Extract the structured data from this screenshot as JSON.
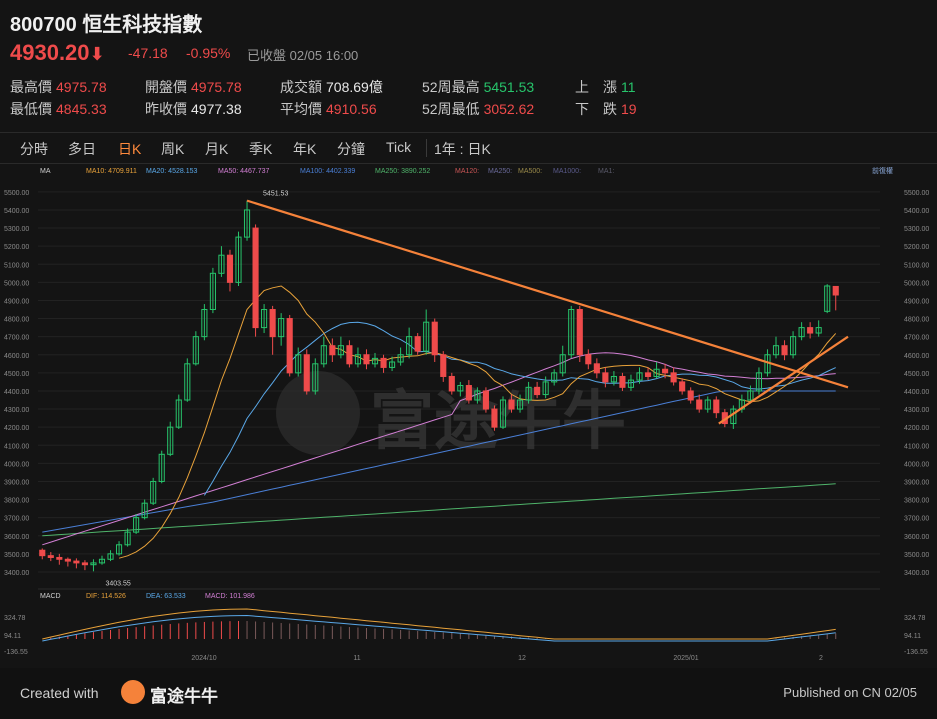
{
  "header": {
    "code": "800700",
    "name": "恒生科技指數",
    "price": "4930.20",
    "arrow": "⬇",
    "change": "-47.18",
    "change_pct": "-0.95%",
    "status": "已收盤 02/05 16:00"
  },
  "stats": [
    {
      "label": "最高價",
      "value": "4975.78",
      "color": "red"
    },
    {
      "label": "開盤價",
      "value": "4975.78",
      "color": "red"
    },
    {
      "label": "成交額",
      "value": "708.69億",
      "color": "white"
    },
    {
      "label": "52周最高",
      "value": "5451.53",
      "color": "green"
    },
    {
      "label": "上　漲",
      "value": "11",
      "color": "green"
    },
    {
      "label": "最低價",
      "value": "4845.33",
      "color": "red"
    },
    {
      "label": "昨收價",
      "value": "4977.38",
      "color": "white"
    },
    {
      "label": "平均價",
      "value": "4910.56",
      "color": "red"
    },
    {
      "label": "52周最低",
      "value": "3052.62",
      "color": "red"
    },
    {
      "label": "下　跌",
      "value": "19",
      "color": "red"
    }
  ],
  "tabs": [
    "分時",
    "多日",
    "日K",
    "周K",
    "月K",
    "季K",
    "年K",
    "分鐘",
    "Tick",
    "1年 : 日K"
  ],
  "active_tab": "日K",
  "ma_legend": [
    {
      "label": "MA",
      "color": "#cfcfcf"
    },
    {
      "label": "MA10: 4709.911",
      "color": "#e8a23a"
    },
    {
      "label": "MA20: 4528.153",
      "color": "#5aa8e8"
    },
    {
      "label": "MA50: 4467.737",
      "color": "#d27fd4"
    },
    {
      "label": "MA100: 4402.339",
      "color": "#4a7fd6"
    },
    {
      "label": "MA250: 3890.252",
      "color": "#4fb36a"
    },
    {
      "label": "MA120:",
      "color": "#c85555"
    },
    {
      "label": "MA250:",
      "color": "#6a6a9a"
    },
    {
      "label": "MA500:",
      "color": "#9a8a4a"
    },
    {
      "label": "MA1000:",
      "color": "#5a5a8a"
    },
    {
      "label": "MA1:",
      "color": "#5a5a6a"
    }
  ],
  "adjust_label": "前復權",
  "macd_legend": [
    {
      "label": "MACD",
      "color": "#cfcfcf"
    },
    {
      "label": "DIF: 114.526",
      "color": "#e8a23a"
    },
    {
      "label": "DEA: 63.533",
      "color": "#5aa8e8"
    },
    {
      "label": "MACD: 101.986",
      "color": "#d27fd4"
    }
  ],
  "watermark": "富途牛牛",
  "footer": {
    "created": "Created with",
    "brand": "富途牛牛",
    "published": "Published on CN 02/05"
  },
  "chart_data": {
    "type": "candlestick",
    "y_ticks": [
      "5500.00",
      "5400.00",
      "5300.00",
      "5200.00",
      "5100.00",
      "5000.00",
      "4900.00",
      "4800.00",
      "4700.00",
      "4600.00",
      "4500.00",
      "4400.00",
      "4300.00",
      "4200.00",
      "4100.00",
      "4000.00",
      "3900.00",
      "3800.00",
      "3700.00",
      "3600.00",
      "3500.00",
      "3400.00"
    ],
    "ylim": [
      3350,
      5560
    ],
    "x_labels": [
      "2024/10",
      "11",
      "12",
      "2025/01",
      "2"
    ],
    "annotations": {
      "high": "5451.53",
      "low": "3403.55"
    },
    "candles": [
      [
        3520,
        3490,
        3530,
        3470
      ],
      [
        3490,
        3480,
        3510,
        3460
      ],
      [
        3480,
        3470,
        3500,
        3440
      ],
      [
        3470,
        3460,
        3480,
        3430
      ],
      [
        3460,
        3450,
        3475,
        3420
      ],
      [
        3450,
        3440,
        3465,
        3410
      ],
      [
        3440,
        3450,
        3470,
        3403.55
      ],
      [
        3450,
        3470,
        3490,
        3440
      ],
      [
        3470,
        3500,
        3520,
        3460
      ],
      [
        3500,
        3550,
        3570,
        3490
      ],
      [
        3550,
        3620,
        3640,
        3540
      ],
      [
        3620,
        3700,
        3720,
        3610
      ],
      [
        3700,
        3780,
        3800,
        3690
      ],
      [
        3780,
        3900,
        3920,
        3770
      ],
      [
        3900,
        4050,
        4070,
        3890
      ],
      [
        4050,
        4200,
        4230,
        4040
      ],
      [
        4200,
        4350,
        4380,
        4190
      ],
      [
        4350,
        4550,
        4580,
        4340
      ],
      [
        4550,
        4700,
        4730,
        4540
      ],
      [
        4700,
        4850,
        4880,
        4680
      ],
      [
        4850,
        5050,
        5080,
        4830
      ],
      [
        5050,
        5150,
        5200,
        5030
      ],
      [
        5150,
        5000,
        5180,
        4950
      ],
      [
        5000,
        5250,
        5280,
        4980
      ],
      [
        5250,
        5400,
        5451.53,
        5230
      ],
      [
        5300,
        4750,
        5320,
        4700
      ],
      [
        4750,
        4850,
        4880,
        4720
      ],
      [
        4850,
        4700,
        4870,
        4600
      ],
      [
        4700,
        4800,
        4830,
        4650
      ],
      [
        4800,
        4500,
        4820,
        4480
      ],
      [
        4500,
        4600,
        4640,
        4480
      ],
      [
        4600,
        4400,
        4630,
        4380
      ],
      [
        4400,
        4550,
        4580,
        4380
      ],
      [
        4550,
        4650,
        4700,
        4530
      ],
      [
        4650,
        4600,
        4690,
        4560
      ],
      [
        4600,
        4650,
        4700,
        4580
      ],
      [
        4650,
        4550,
        4680,
        4530
      ],
      [
        4550,
        4600,
        4640,
        4530
      ],
      [
        4600,
        4550,
        4630,
        4520
      ],
      [
        4550,
        4580,
        4610,
        4530
      ],
      [
        4580,
        4530,
        4600,
        4500
      ],
      [
        4530,
        4560,
        4590,
        4510
      ],
      [
        4560,
        4600,
        4640,
        4540
      ],
      [
        4600,
        4700,
        4750,
        4580
      ],
      [
        4700,
        4620,
        4720,
        4600
      ],
      [
        4620,
        4780,
        4850,
        4600
      ],
      [
        4780,
        4600,
        4800,
        4560
      ],
      [
        4600,
        4480,
        4620,
        4450
      ],
      [
        4480,
        4400,
        4500,
        4380
      ],
      [
        4400,
        4430,
        4450,
        4370
      ],
      [
        4430,
        4350,
        4460,
        4330
      ],
      [
        4350,
        4400,
        4420,
        4330
      ],
      [
        4400,
        4300,
        4420,
        4280
      ],
      [
        4300,
        4200,
        4320,
        4180
      ],
      [
        4200,
        4350,
        4370,
        4190
      ],
      [
        4350,
        4300,
        4380,
        4280
      ],
      [
        4300,
        4350,
        4380,
        4280
      ],
      [
        4350,
        4420,
        4450,
        4330
      ],
      [
        4420,
        4380,
        4450,
        4360
      ],
      [
        4380,
        4450,
        4480,
        4360
      ],
      [
        4450,
        4500,
        4520,
        4430
      ],
      [
        4500,
        4600,
        4650,
        4480
      ],
      [
        4600,
        4850,
        4870,
        4580
      ],
      [
        4850,
        4600,
        4870,
        4560
      ],
      [
        4600,
        4550,
        4630,
        4520
      ],
      [
        4550,
        4500,
        4580,
        4470
      ],
      [
        4500,
        4450,
        4530,
        4420
      ],
      [
        4450,
        4480,
        4510,
        4430
      ],
      [
        4480,
        4420,
        4500,
        4400
      ],
      [
        4420,
        4460,
        4490,
        4400
      ],
      [
        4460,
        4500,
        4530,
        4440
      ],
      [
        4500,
        4480,
        4530,
        4460
      ],
      [
        4480,
        4520,
        4560,
        4470
      ],
      [
        4520,
        4500,
        4550,
        4470
      ],
      [
        4500,
        4450,
        4530,
        4430
      ],
      [
        4450,
        4400,
        4470,
        4380
      ],
      [
        4400,
        4350,
        4420,
        4330
      ],
      [
        4350,
        4300,
        4380,
        4280
      ],
      [
        4300,
        4350,
        4370,
        4280
      ],
      [
        4350,
        4280,
        4370,
        4250
      ],
      [
        4280,
        4220,
        4300,
        4200
      ],
      [
        4220,
        4300,
        4320,
        4190
      ],
      [
        4300,
        4350,
        4380,
        4280
      ],
      [
        4350,
        4400,
        4430,
        4330
      ],
      [
        4400,
        4500,
        4530,
        4380
      ],
      [
        4500,
        4600,
        4630,
        4480
      ],
      [
        4600,
        4650,
        4700,
        4580
      ],
      [
        4650,
        4600,
        4680,
        4570
      ],
      [
        4600,
        4700,
        4730,
        4580
      ],
      [
        4700,
        4750,
        4780,
        4680
      ],
      [
        4750,
        4720,
        4780,
        4690
      ],
      [
        4720,
        4750,
        4790,
        4700
      ],
      [
        4840,
        4980,
        4990,
        4830
      ],
      [
        4977.38,
        4930.2,
        4975.78,
        4845.33
      ]
    ]
  }
}
